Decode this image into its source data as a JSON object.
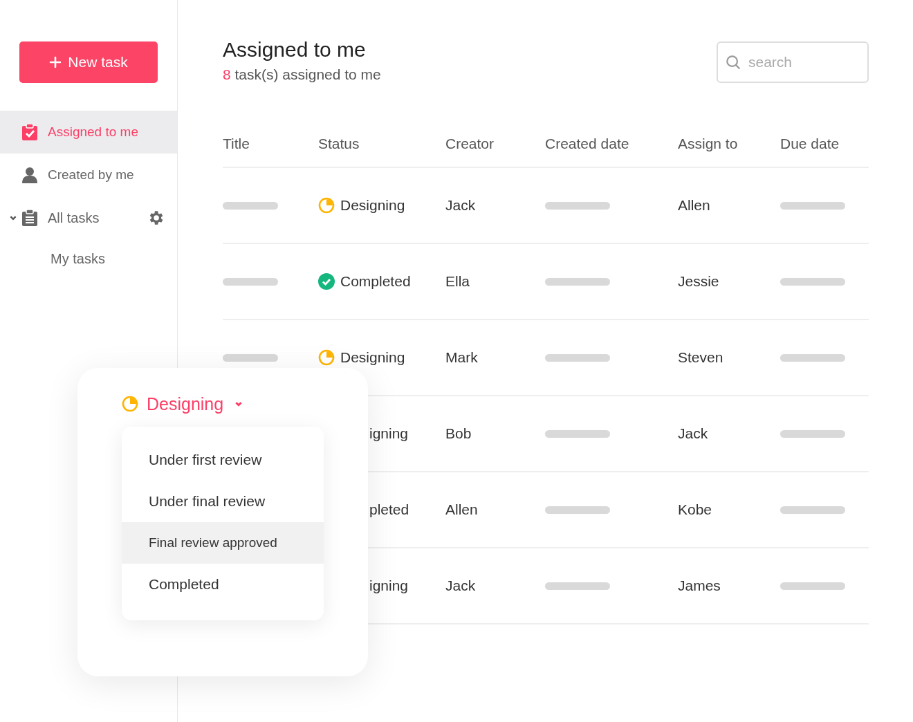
{
  "new_task_button": {
    "label": "New task"
  },
  "sidebar": {
    "items": [
      {
        "label": "Assigned to me",
        "selected": true
      },
      {
        "label": "Created by me",
        "selected": false
      },
      {
        "label": "All tasks",
        "selected": false,
        "expanded": true,
        "children": [
          {
            "label": "My tasks",
            "selected": false
          }
        ]
      }
    ]
  },
  "header": {
    "title": "Assigned to me",
    "count": "8",
    "count_text": "task(s) assigned to me"
  },
  "search": {
    "placeholder": "search"
  },
  "table": {
    "columns": [
      "Title",
      "Status",
      "Creator",
      "Created date",
      "Assign to",
      "Due date"
    ],
    "rows": [
      {
        "kind": "designing",
        "status": "Designing",
        "creator": "Jack",
        "assignee": "Allen"
      },
      {
        "kind": "completed",
        "status": "Completed",
        "creator": "Ella",
        "assignee": "Jessie"
      },
      {
        "kind": "designing",
        "status": "Designing",
        "creator": "Mark",
        "assignee": "Steven"
      },
      {
        "status": "igning",
        "creator": "Bob",
        "assignee": "Jack"
      },
      {
        "status": "pleted",
        "creator": "Allen",
        "assignee": "Kobe"
      },
      {
        "status": "igning",
        "creator": "Jack",
        "assignee": "James"
      }
    ]
  },
  "status_popup": {
    "current": "Designing",
    "kind": "designing",
    "options": [
      {
        "label": "Under first review",
        "selected": false
      },
      {
        "label": "Under final review",
        "selected": false
      },
      {
        "label": "Final review approved",
        "selected": true
      },
      {
        "label": "Completed",
        "selected": false
      }
    ]
  }
}
